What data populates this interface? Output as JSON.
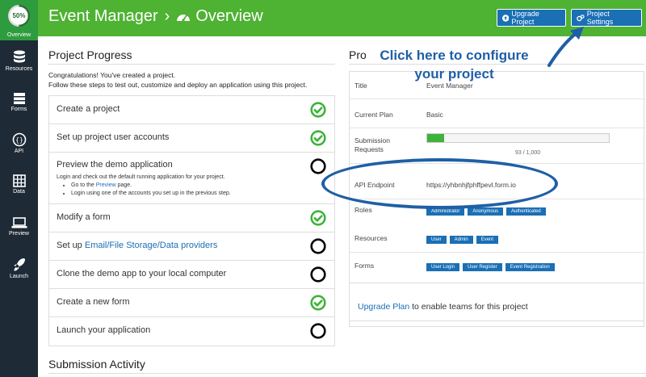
{
  "sidebar": {
    "progress": {
      "percent_label": "50%",
      "percent": 50,
      "label": "Overview"
    },
    "items": [
      {
        "label": "Resources",
        "icon": "database-icon"
      },
      {
        "label": "Forms",
        "icon": "forms-icon"
      },
      {
        "label": "API",
        "icon": "api-icon"
      },
      {
        "label": "Data",
        "icon": "table-icon"
      },
      {
        "label": "Preview",
        "icon": "laptop-icon"
      },
      {
        "label": "Launch",
        "icon": "rocket-icon"
      }
    ]
  },
  "header": {
    "app": "Event Manager",
    "separator": "›",
    "page": "Overview",
    "upgrade_label": "Upgrade Project",
    "settings_label": "Project Settings"
  },
  "progress": {
    "title": "Project Progress",
    "intro1": "Congratulations! You've created a project.",
    "intro2": "Follow these steps to test out, customize and deploy an application using this project.",
    "steps": [
      {
        "label": "Create a project",
        "done": true
      },
      {
        "label": "Set up project user accounts",
        "done": true
      },
      {
        "label": "Preview the demo application",
        "done": false,
        "desc": "Login and check out the default running application for your project.",
        "bullet1_pre": "Go to the ",
        "bullet1_link": "Preview",
        "bullet1_post": " page.",
        "bullet2": "Login using one of the accounts you set up in the previous step."
      },
      {
        "label": "Modify a form",
        "done": true
      },
      {
        "label_pre": "Set up ",
        "label_link": "Email/File Storage/Data providers",
        "done": false
      },
      {
        "label": "Clone the demo app to your local computer",
        "done": false
      },
      {
        "label": "Create a new form",
        "done": true
      },
      {
        "label": "Launch your application",
        "done": false
      }
    ]
  },
  "info": {
    "title_visible": "Pro",
    "rows": {
      "title": {
        "k": "Title",
        "v": "Event Manager"
      },
      "plan": {
        "k": "Current Plan",
        "v": "Basic"
      },
      "subs": {
        "k": "Submission Requests",
        "count": "93 / 1,000",
        "fraction": 0.093
      },
      "api": {
        "k": "API Endpoint",
        "v": "https://yhbnhjfphffpevl.form.io"
      },
      "roles": {
        "k": "Roles",
        "tags": [
          "Administrator",
          "Anonymous",
          "Authenticated"
        ]
      },
      "resources": {
        "k": "Resources",
        "tags": [
          "User",
          "Admin",
          "Event"
        ]
      },
      "forms": {
        "k": "Forms",
        "tags": [
          "User Login",
          "User Register",
          "Event Registration"
        ]
      }
    },
    "upgrade_link": "Upgrade Plan",
    "upgrade_text": " to enable teams for this project"
  },
  "activity": {
    "title": "Submission Activity"
  },
  "annotation": {
    "line1": "Click here to configure",
    "line2": "your project"
  },
  "colors": {
    "header": "#4eb232",
    "sidebar": "#1e2a36",
    "accent": "#1a6fb5",
    "check": "#3eb33a",
    "annotation": "#1f5fa6"
  }
}
